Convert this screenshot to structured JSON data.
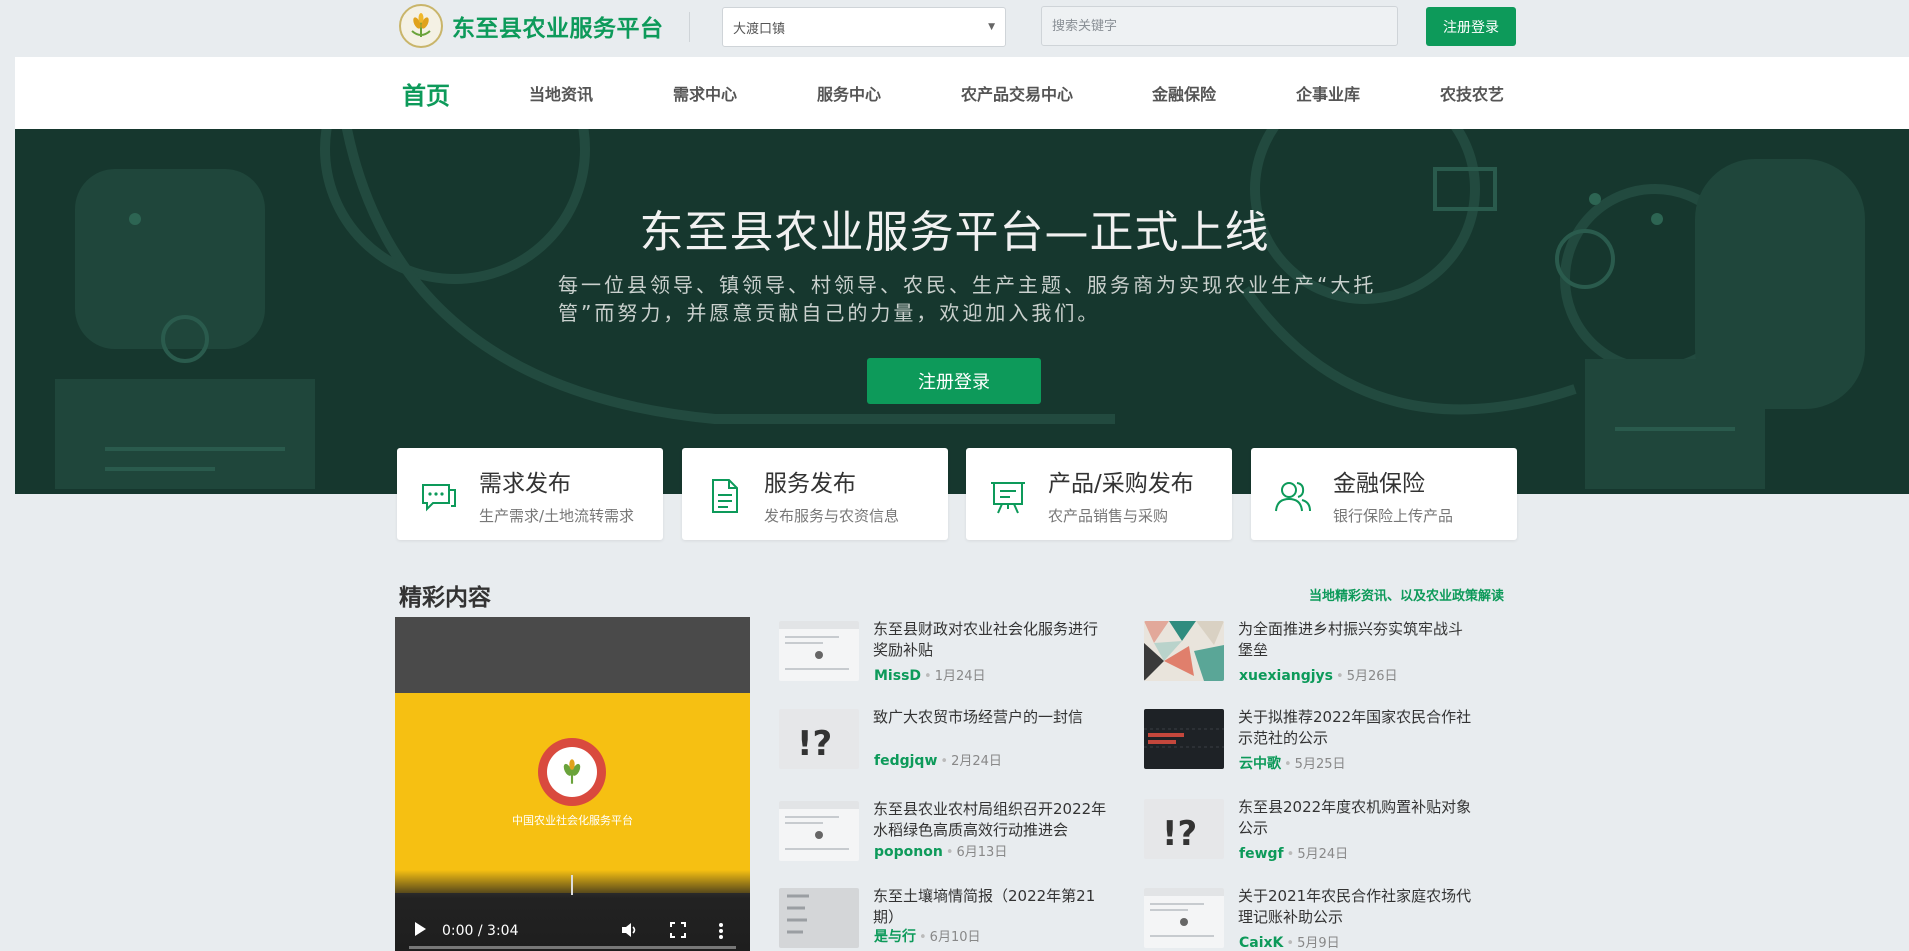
{
  "brand": {
    "title": "东至县农业服务平台"
  },
  "town_select": {
    "value": "大渡口镇"
  },
  "search": {
    "placeholder": "搜索关键字"
  },
  "top_register_label": "注册登录",
  "nav": {
    "items": [
      {
        "label": "首页",
        "active": true
      },
      {
        "label": "当地资讯"
      },
      {
        "label": "需求中心"
      },
      {
        "label": "服务中心"
      },
      {
        "label": "农产品交易中心"
      },
      {
        "label": "金融保险"
      },
      {
        "label": "企事业库"
      },
      {
        "label": "农技农艺"
      }
    ]
  },
  "hero": {
    "title": "东至县农业服务平台—正式上线",
    "desc": "每一位县领导、镇领导、村领导、农民、生产主题、服务商为实现农业生产“大托管”而努力，并愿意贡献自己的力量，欢迎加入我们。",
    "button_label": "注册登录"
  },
  "features": [
    {
      "title": "需求发布",
      "subtitle": "生产需求/土地流转需求",
      "icon": "chat-bubbles-icon"
    },
    {
      "title": "服务发布",
      "subtitle": "发布服务与农资信息",
      "icon": "document-icon"
    },
    {
      "title": "产品/采购发布",
      "subtitle": "农产品销售与采购",
      "icon": "presentation-board-icon"
    },
    {
      "title": "金融保险",
      "subtitle": "银行保险上传产品",
      "icon": "users-icon"
    }
  ],
  "section": {
    "title": "精彩内容",
    "link": "当地精彩资讯、以及农业政策解读"
  },
  "video": {
    "caption": "中国农业社会化服务平台",
    "time": "0:00 / 3:04",
    "progress": 0
  },
  "news": [
    {
      "title": "东至县财政对农业社会化服务进行奖励补贴",
      "author": "MissD",
      "date": "1月24日",
      "thumb": "doc"
    },
    {
      "title": "为全面推进乡村振兴夯实筑牢战斗堡垒",
      "author": "xuexiangjys",
      "date": "5月26日",
      "thumb": "pattern"
    },
    {
      "title": "致广大农贸市场经营户的一封信",
      "author": "fedgjqw",
      "date": "2月24日",
      "thumb": "question"
    },
    {
      "title": "关于拟推荐2022年国家农民合作社示范社的公示",
      "author": "云中歌",
      "date": "5月25日",
      "thumb": "dark"
    },
    {
      "title": "东至县农业农村局组织召开2022年水稻绿色高质高效行动推进会",
      "author": "poponon",
      "date": "6月13日",
      "thumb": "doc"
    },
    {
      "title": "东至县2022年度农机购置补贴对象公示",
      "author": "fewgf",
      "date": "5月24日",
      "thumb": "question"
    },
    {
      "title": "东至土壤墒情简报（2022年第21期）",
      "author": "是与行",
      "date": "6月10日",
      "thumb": "list"
    },
    {
      "title": "关于2021年农民合作社家庭农场代理记账补助公示",
      "author": "CaixK",
      "date": "5月9日",
      "thumb": "doc"
    }
  ],
  "colors": {
    "accent": "#0d9a5a",
    "hero_bg": "#16372e",
    "video_bg": "#f6c012"
  }
}
